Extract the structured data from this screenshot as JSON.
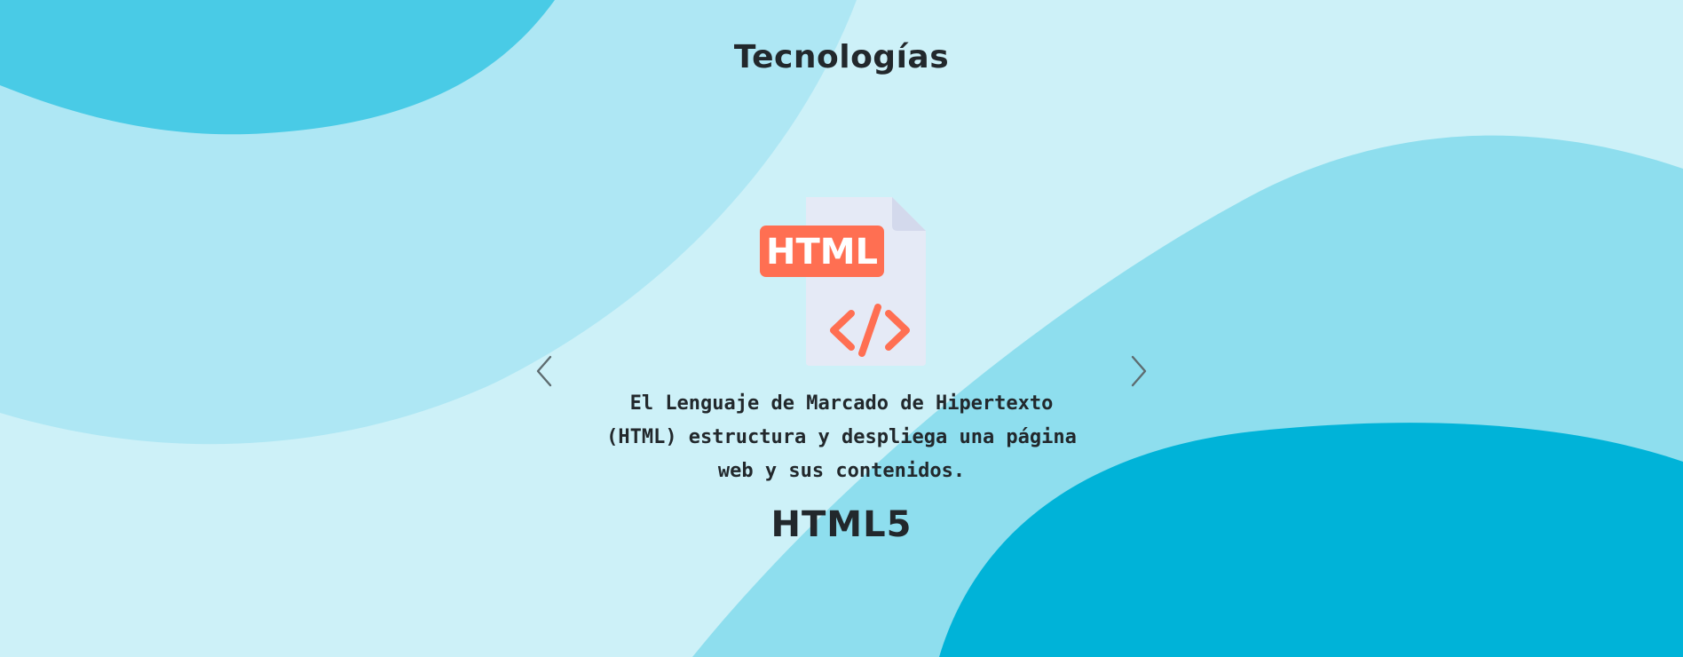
{
  "section": {
    "title": "Tecnologías"
  },
  "carousel": {
    "prev_icon": "chevron-left-icon",
    "next_icon": "chevron-right-icon",
    "slide": {
      "image_icon": "html-file-icon",
      "image_badge_text": "HTML",
      "description": "El Lenguaje de Marcado de Hipertexto (HTML) estructura y despliega una página web y sus contenidos.",
      "caption": "HTML5"
    }
  },
  "colors": {
    "background": "#cdf1f8",
    "blob_light": "#aee7f4",
    "blob_mid": "#8edeee",
    "blob_accent": "#49cbe6",
    "blob_dark": "#00b3d8",
    "badge": "#ff6f52",
    "text": "#22282c"
  }
}
